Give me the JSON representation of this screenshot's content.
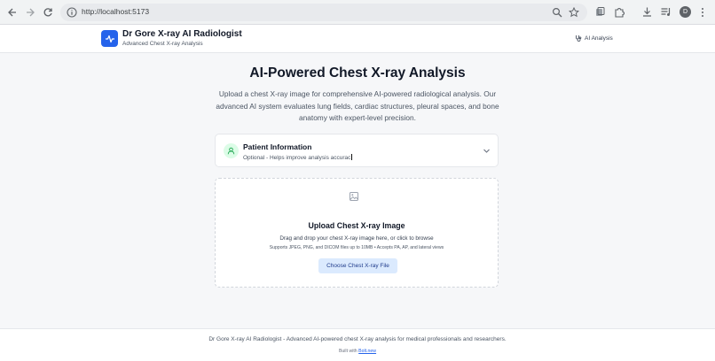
{
  "browser": {
    "url": "http://localhost:5173",
    "profile_initial": "D",
    "icons": [
      "back-icon",
      "forward-icon",
      "reload-icon",
      "site-info-icon",
      "zoom-icon",
      "bookmark-star-icon",
      "extension-icon",
      "puzzle-icon",
      "download-icon",
      "reading-list-icon",
      "menu-icon"
    ]
  },
  "header": {
    "title": "Dr Gore X-ray AI Radiologist",
    "subtitle": "Advanced Chest X-ray Analysis",
    "nav_label": "AI Analysis"
  },
  "hero": {
    "title": "AI-Powered Chest X-ray Analysis",
    "description": "Upload a chest X-ray image for comprehensive AI-powered radiological analysis. Our advanced AI system evaluates lung fields, cardiac structures, pleural spaces, and bone anatomy with expert-level precision."
  },
  "patient": {
    "title": "Patient Information",
    "subtitle": "Optional - Helps improve analysis accurac"
  },
  "upload": {
    "title": "Upload Chest X-ray Image",
    "description": "Drag and drop your chest X-ray image here, or click to browse",
    "note": "Supports JPEG, PNG, and DICOM files up to 10MB • Accepts PA, AP, and lateral views",
    "button_label": "Choose Chest X-ray File"
  },
  "footer": {
    "text": "Dr Gore X-ray AI Radiologist - Advanced AI-powered chest X-ray analysis for medical professionals and researchers.",
    "built_prefix": "Built with",
    "built_link": "Bolt.new"
  },
  "colors": {
    "accent": "#2563eb",
    "button_bg": "#dbeafe",
    "patient_icon_bg": "#dcfce7",
    "patient_icon": "#16a34a"
  }
}
